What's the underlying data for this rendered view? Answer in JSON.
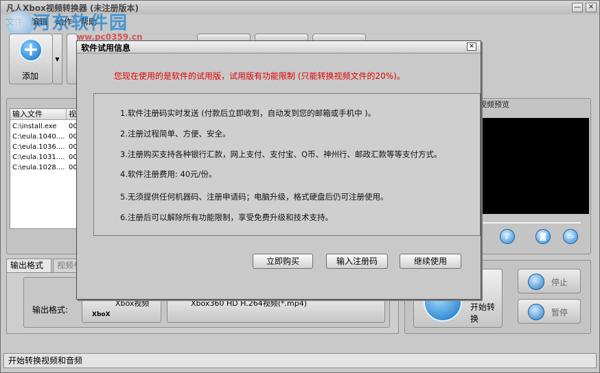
{
  "window": {
    "title": "凡人Xbox视频转换器   (未注册版本)",
    "minimize": "—",
    "close": "✕"
  },
  "menu": [
    "文件",
    "编辑",
    "动作",
    "帮助"
  ],
  "watermark": {
    "text": "河东软件园",
    "url": "www.pc0359.cn"
  },
  "toolbar": {
    "add_label": "添加",
    "add_dropdown": "▼"
  },
  "file_list": {
    "headers": [
      "输入文件",
      "视"
    ],
    "rows": [
      {
        "name": "C:\\install.exe",
        "len": "00"
      },
      {
        "name": "C:\\eula.1040....",
        "len": "00"
      },
      {
        "name": "C:\\eula.1036....",
        "len": "00"
      },
      {
        "name": "C:\\eula.1031....",
        "len": "00"
      },
      {
        "name": "C:\\eula.1028....",
        "len": "00"
      }
    ]
  },
  "preview": {
    "title": "视频预览",
    "controls": [
      "audio-icon",
      "snapshot-icon",
      "folder-icon"
    ]
  },
  "tabs": [
    "输出格式",
    "视频参"
  ],
  "output": {
    "label": "输出格式:",
    "xbox_text": "Xbox视频",
    "xbox_tag": "XboX",
    "mp4_text": "Xbox360 HD H.264视频(*.mp4)"
  },
  "convert": {
    "label": "开始转换",
    "stop": "停止",
    "pause": "暂停"
  },
  "status": "开始转换视频和音频",
  "dialog": {
    "title": "软件试用信息",
    "close": "✕",
    "warning": "您现在使用的是软件的试用版，试用版有功能限制 (只能转换视频文件的20%)。",
    "info_lines": [
      "1.软件注册码实时发送 (付款后立即收到，自动发到您的邮箱或手机中 )。",
      "2.注册过程简单、方便、安全。",
      "3.注册购买支持各种银行汇款，网上支付、支付宝、Q币、神州行、邮政汇款等等支付方式。",
      "4.软件注册费用: 40元/份。",
      "5.无须提供任何机器码、注册申请码；电脑升级，格式硬盘后仍可注册使用。",
      "6.注册后可以解除所有功能限制，享受免费升级和技术支持。"
    ],
    "buttons": {
      "buy": "立即购买",
      "enter_code": "输入注册码",
      "continue": "继续使用"
    }
  }
}
